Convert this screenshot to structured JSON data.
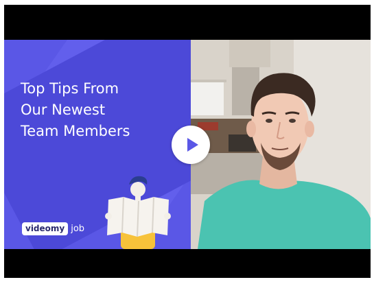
{
  "video": {
    "headline_lines": [
      "Top Tips From",
      "Our Newest",
      "Team Members"
    ],
    "logo": {
      "pill_text": "videomy",
      "rest_text": "job"
    },
    "play_icon": "play-icon",
    "colors": {
      "panel": "#5a57e6",
      "play_button": "#ffffff",
      "play_glyph": "#5a57e6"
    }
  }
}
